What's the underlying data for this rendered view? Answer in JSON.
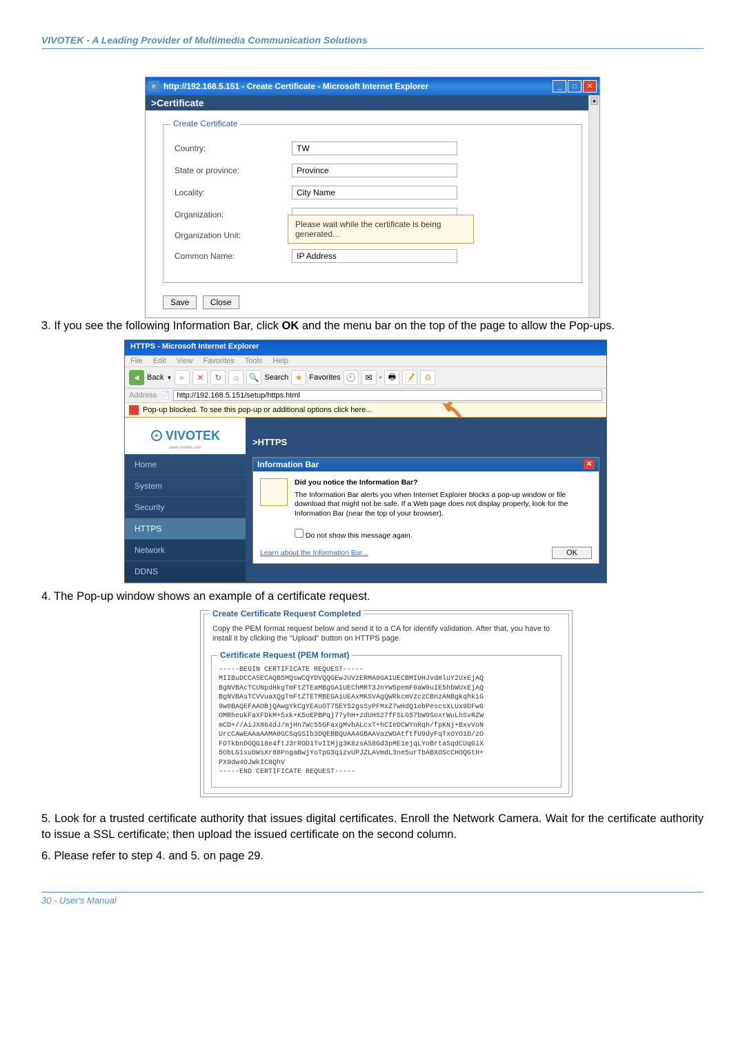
{
  "header": "VIVOTEK - A Leading Provider of Multimedia Communication Solutions",
  "footer": "30 - User's Manual",
  "step3": {
    "prefix": "3. If you see the following Information Bar, click ",
    "bold": "OK",
    "suffix": " and the menu bar on the top of the page to allow the Pop-ups."
  },
  "step4": "4. The Pop-up window shows an example of a certificate request.",
  "step5": "5. Look for a trusted certificate authority that issues digital certificates. Enroll the Network Camera. Wait for the certificate authority to issue a SSL certificate; then upload the issued certificate on the second column.",
  "step6": "6. Please refer to step 4. and 5. on page 29.",
  "ie1": {
    "title": "http://192.168.5.151 - Create Certificate - Microsoft Internet Explorer",
    "section_title": ">Certificate",
    "fieldset_legend": "Create Certificate",
    "country_label": "Country:",
    "country_value": "TW",
    "state_label": "State or province:",
    "state_value": "Province",
    "locality_label": "Locality:",
    "locality_value": "City Name",
    "org_label": "Organization:",
    "org_unit_label": "Organization Unit:",
    "common_label": "Common Name:",
    "common_value": "IP Address",
    "popup_text": "Please wait while the certificate is being generated...",
    "save_btn": "Save",
    "close_btn": "Close"
  },
  "ie2": {
    "title": "HTTPS - Microsoft Internet Explorer",
    "menu": {
      "file": "File",
      "edit": "Edit",
      "view": "View",
      "favorites": "Favorites",
      "tools": "Tools",
      "help": "Help"
    },
    "toolbar": {
      "back": "Back",
      "search": "Search",
      "favorites": "Favorites"
    },
    "address_label": "Address",
    "address_value": "http://192.168.5.151/setup/https.html",
    "infobar_text": "Pop-up blocked. To see this pop-up or additional options click here...",
    "logo": "VIVOTEK",
    "nav": {
      "home": "Home",
      "system": "System",
      "security": "Security",
      "https": "HTTPS",
      "network": "Network",
      "ddns": "DDNS"
    },
    "https_header": ">HTTPS",
    "dialog": {
      "title": "Information Bar",
      "heading": "Did you notice the Information Bar?",
      "body": "The Information Bar alerts you when Internet Explorer blocks a pop-up window or file download that might not be safe. If a Web page does not display properly, look for the Information Bar (near the top of your browser).",
      "checkbox": "Do not show this message again.",
      "link": "Learn about the Information Bar...",
      "ok": "OK"
    }
  },
  "certreq": {
    "fieldset_legend": "Create Certificate Request Completed",
    "intro": "Copy the PEM format request below and send it to a CA for identify validation. After that, you have to install it by clicking the \"Upload\" button on HTTPS page.",
    "pem_legend": "Certificate Request (PEM format)",
    "pem": "-----BEGIN CERTIFICATE REQUEST-----\nMIIBuDCCASECAQB5MQswCQYDVQQGEwJUVzERMA8GA1UECBMIUHJvdmluY2UxEjAQ\nBgNVBAcTCUNpdHkgTmFtZTEaMBgGA1UEChMRT3JnYW5pemF0aW9uIE5hbWUxEjAQ\nBgNVBAsTCVVuaXQgTmFtZTETMBEGA1UEAxMKSVAgQWRkcmVzczCBnzANBgkqhkiG\n9w0BAQEFAAOBjQAwgYkCgYEAuOT75EY52gsSyPFMxZ7wHdQ1obPescsXLUx9DFw6\nOMRheukFaXFDkM+5xk+K5oEPBPqj77yhH+zdUHS27fFSLG57bW9SoxrWuLhSvRZW\nmCD+//AiJX864dJ/mjHn7Wc55GFaxgMvbALcxT+hCIeDCWYnRqh/fpKNj+BxvVoN\nUrcCAwEAAaAAMA0GCSqGSIb3DQEBBQUAA4GBAAVazWOAtftfU9dyFqTxOYO1D/zO\nFOTkbnDOQG18e4ftJ3rROD1TvIIMjg3K8zsAS8Gd3pME1ejqLYoBrtaSqdCUqGiX\n5ObLG1subWsXr88PngaBwjYoTpG3q1zvUPJZLAVmdL3ne5urTbABXOScCHOQGtH+\nPX9dw4OJWkIC8QhV\n-----END CERTIFICATE REQUEST-----"
  }
}
